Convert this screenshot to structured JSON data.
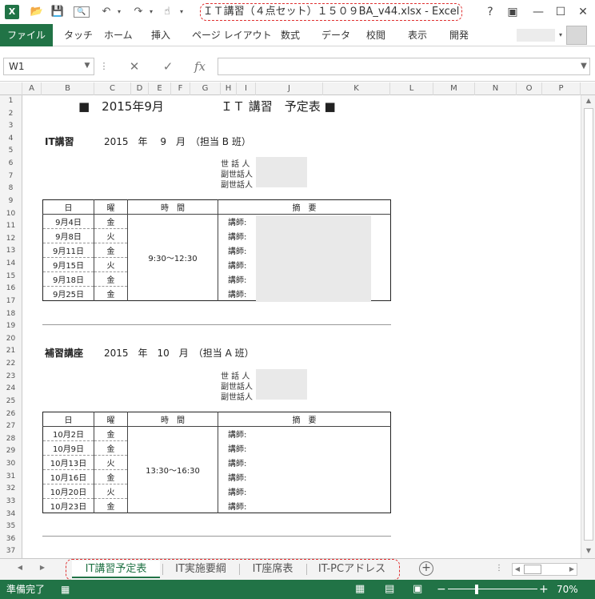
{
  "window": {
    "title": "ＩＴ講習（４点セット）１５０９BA_v44.xlsx - Excel",
    "help": "?",
    "ribbon_display": "▣",
    "minimize": "—",
    "maximize": "☐",
    "close": "✕"
  },
  "quick_access": {
    "save": "💾",
    "undo": "↶",
    "redo": "↷"
  },
  "ribbon": {
    "file": "ファイル",
    "tabs": [
      "タッチ",
      "ホーム",
      "挿入",
      "ページ レイアウト",
      "数式",
      "データ",
      "校閲",
      "表示",
      "開発"
    ]
  },
  "formula_bar": {
    "name_box": "W1",
    "cancel": "✕",
    "enter": "✓",
    "fx": "fx",
    "value": ""
  },
  "columns": [
    "A",
    "B",
    "C",
    "D",
    "E",
    "F",
    "G",
    "H",
    "I",
    "J",
    "K",
    "L",
    "M",
    "N",
    "O",
    "P"
  ],
  "rows": [
    "1",
    "2",
    "3",
    "4",
    "5",
    "6",
    "7",
    "8",
    "9",
    "10",
    "11",
    "12",
    "13",
    "14",
    "15",
    "16",
    "17",
    "18",
    "19",
    "20",
    "21",
    "22",
    "23",
    "24",
    "25",
    "26",
    "27",
    "28",
    "29",
    "30",
    "31",
    "32",
    "33",
    "34",
    "35",
    "36",
    "37"
  ],
  "sheet": {
    "title_left": "■　2015年9月",
    "title_right": "ＩＴ 講習　予定表 ■",
    "sec1": {
      "name": "IT講習",
      "detail": "2015　年　 9　月　（担当 B 班）",
      "host": "世 話 人",
      "sub1": "副世話人",
      "sub2": "副世話人",
      "headers": [
        "日",
        "曜",
        "時　間",
        "摘　要"
      ],
      "time": "9:30〜12:30",
      "rows": [
        {
          "date": "9月4日",
          "day": "金",
          "note": "講師:"
        },
        {
          "date": "9月8日",
          "day": "火",
          "note": "講師:"
        },
        {
          "date": "9月11日",
          "day": "金",
          "note": "講師:"
        },
        {
          "date": "9月15日",
          "day": "火",
          "note": "講師:"
        },
        {
          "date": "9月18日",
          "day": "金",
          "note": "講師:"
        },
        {
          "date": "9月25日",
          "day": "金",
          "note": "講師:"
        }
      ]
    },
    "sec2": {
      "name": "補習講座",
      "detail": "2015　年　10　月　（担当 A 班）",
      "host": "世 話 人",
      "sub1": "副世話人",
      "sub2": "副世話人",
      "headers": [
        "日",
        "曜",
        "時　間",
        "摘　要"
      ],
      "time": "13:30〜16:30",
      "rows": [
        {
          "date": "10月2日",
          "day": "金",
          "note": "講師:"
        },
        {
          "date": "10月9日",
          "day": "金",
          "note": "講師:"
        },
        {
          "date": "10月13日",
          "day": "火",
          "note": "講師:"
        },
        {
          "date": "10月16日",
          "day": "金",
          "note": "講師:"
        },
        {
          "date": "10月20日",
          "day": "火",
          "note": "講師:"
        },
        {
          "date": "10月23日",
          "day": "金",
          "note": "講師:"
        }
      ]
    }
  },
  "sheet_tabs": [
    "IT講習予定表",
    "IT実施要綱",
    "IT座席表",
    "IT-PCアドレス"
  ],
  "add_sheet": "+",
  "status": {
    "ready": "準備完了",
    "zoom": "70%",
    "zoom_minus": "−",
    "zoom_plus": "+"
  }
}
